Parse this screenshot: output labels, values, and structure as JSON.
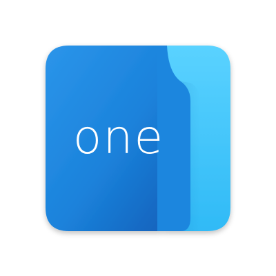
{
  "app_icon": {
    "wordmark": "one",
    "colors": {
      "background": "#ffffff",
      "tile_primary": "#1a80d8",
      "tile_primary_light": "#2b95ea",
      "tile_primary_dark": "#1466c0",
      "folded_strip": "#3cc3fb",
      "folded_strip_light": "#5ad2ff",
      "folded_strip_shadow": "#1a9fe0",
      "wordmark": "#ffffff"
    },
    "icon_name": "app-logo-icon"
  }
}
